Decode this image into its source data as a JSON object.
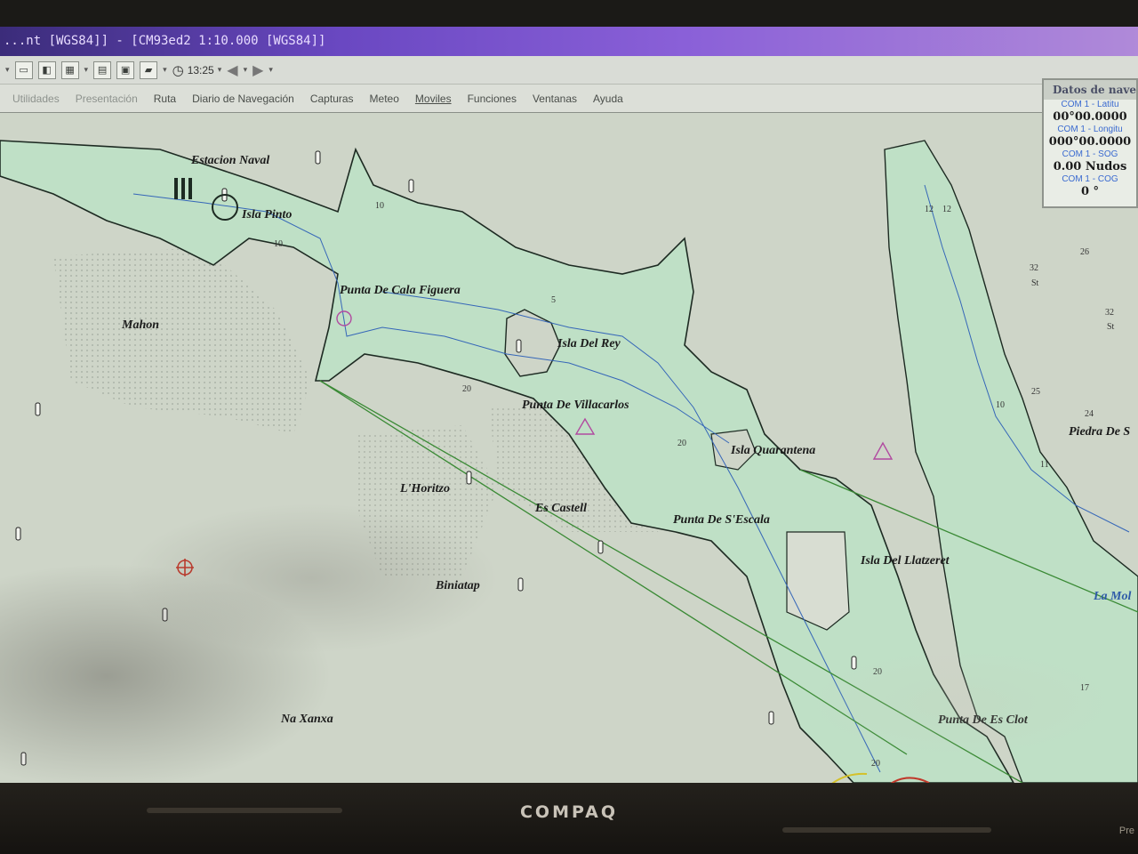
{
  "window": {
    "title": "...nt [WGS84]] - [CM93ed2 1:10.000 [WGS84]]"
  },
  "toolbar": {
    "time": "13:25",
    "icons": [
      "window-icon",
      "layers-icon",
      "grid-icon",
      "print-icon",
      "config-icon",
      "folder-icon",
      "clock-icon",
      "back-arrow-icon",
      "forward-arrow-icon"
    ]
  },
  "menu": {
    "items": [
      {
        "label": "Utilidades",
        "dim": true
      },
      {
        "label": "Presentación",
        "dim": true
      },
      {
        "label": "Ruta",
        "dim": false
      },
      {
        "label": "Diario de Navegación",
        "dim": false
      },
      {
        "label": "Capturas",
        "dim": false
      },
      {
        "label": "Meteo",
        "dim": false
      },
      {
        "label": "Moviles",
        "dim": false
      },
      {
        "label": "Funciones",
        "dim": false
      },
      {
        "label": "Ventanas",
        "dim": false
      },
      {
        "label": "Ayuda",
        "dim": false
      }
    ]
  },
  "nav_panel": {
    "title": "Datos de nave",
    "rows": [
      {
        "label": "COM 1 - Latitu",
        "value": "00°00.0000"
      },
      {
        "label": "COM 1 - Longitu",
        "value": "000°00.0000"
      },
      {
        "label": "COM 1 - SOG",
        "value": "0.00 Nudos"
      },
      {
        "label": "COM 1 - COG",
        "value": "0 °"
      }
    ]
  },
  "chart_labels": {
    "estacion_naval": "Estacion Naval",
    "isla_pinto": "Isla Pinto",
    "punta_cala_figuera": "Punta De Cala Figuera",
    "mahon": "Mahon",
    "isla_del_rey": "Isla Del Rey",
    "punta_villacarlos": "Punta De Villacarlos",
    "isla_quarantena": "Isla Quarantena",
    "l_horitzo": "L'Horitzo",
    "es_castell": "Es Castell",
    "punta_s_escala": "Punta De S'Escala",
    "isla_llatzeret": "Isla Del Llatzeret",
    "biniatap": "Biniatap",
    "na_xanxa": "Na Xanxa",
    "punta_es_clot": "Punta De Es Clot",
    "piedra": "Piedra De S",
    "la_mola": "La Mol"
  },
  "depths": [
    "10",
    "10",
    "5",
    "20",
    "20",
    "20",
    "12",
    "32",
    "32",
    "26",
    "25",
    "24",
    "10",
    "11",
    "12",
    "20",
    "17",
    "St",
    "St"
  ],
  "bezel": {
    "logo": "COMPAQ",
    "model": "Pre"
  }
}
